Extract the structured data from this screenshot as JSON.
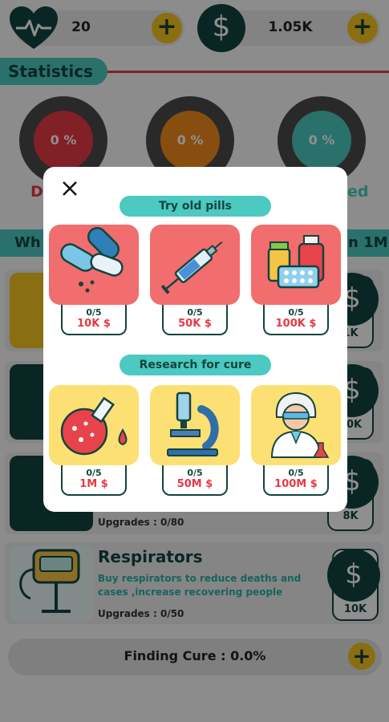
{
  "topbar": {
    "health_value": "20",
    "money_value": "1.05K",
    "money_symbol": "$"
  },
  "statistics": {
    "title": "Statistics",
    "gauges": [
      {
        "value": "0 %",
        "color": "#e63946"
      },
      {
        "value": "0 %",
        "color": "#f28c1e"
      },
      {
        "value": "0 %",
        "color": "#4cc9c0"
      }
    ],
    "left_label_fragment": "D",
    "right_label_fragment": "ed"
  },
  "what_bar": {
    "left_fragment": "Wh",
    "right_fragment": "n 1M"
  },
  "cards": [
    {
      "price": "1K"
    },
    {
      "price": "60K"
    },
    {
      "price": "8K",
      "upgrades": "Upgrades : 0/80"
    },
    {
      "title": "Respirators",
      "description": "Buy respirators to reduce deaths and cases ,increase recovering people",
      "upgrades": "Upgrades : 0/50",
      "price": "10K"
    }
  ],
  "finding_cure": "Finding Cure : 0.0%",
  "modal": {
    "sections": [
      {
        "title": "Try old pills",
        "items": [
          {
            "icon": "pills-icon",
            "progress": "0/5",
            "cost": "10K $"
          },
          {
            "icon": "syringe-icon",
            "progress": "0/5",
            "cost": "50K $"
          },
          {
            "icon": "medicine-bottles-icon",
            "progress": "0/5",
            "cost": "100K $"
          }
        ]
      },
      {
        "title": "Research for cure",
        "items": [
          {
            "icon": "flask-icon",
            "progress": "0/5",
            "cost": "1M $"
          },
          {
            "icon": "microscope-icon",
            "progress": "0/5",
            "cost": "50M $"
          },
          {
            "icon": "scientist-icon",
            "progress": "0/5",
            "cost": "100M $"
          }
        ]
      }
    ]
  },
  "colors": {
    "dark_teal": "#124440",
    "teal": "#4cc9c0",
    "red": "#e63946",
    "yellow": "#fde073",
    "tile_red": "#f26d6d",
    "gold": "#f4c520"
  }
}
